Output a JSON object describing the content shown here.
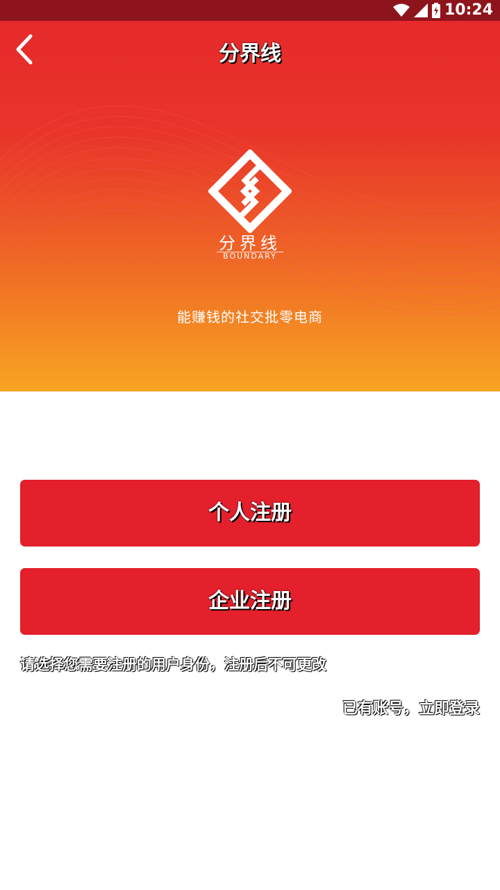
{
  "status_bar": {
    "time": "10:24",
    "icons": [
      "wifi-icon",
      "cellular-signal-icon",
      "battery-icon"
    ]
  },
  "header": {
    "title": "分界线",
    "back_icon": "chevron-left-icon"
  },
  "brand": {
    "name": "分界线",
    "english": "BOUNDARY",
    "slogan": "能赚钱的社交批零电商"
  },
  "actions": {
    "personal_register": "个人注册",
    "enterprise_register": "企业注册"
  },
  "hint_text": "请选择您需要注册的用户身份，注册后不可更改",
  "login_link": "已有账号，立即登录",
  "colors": {
    "status_bar": "#8e141b",
    "gradient_top": "#e62a2b",
    "gradient_bottom": "#f8a422",
    "button": "#e3202b",
    "background": "#ffffff"
  }
}
